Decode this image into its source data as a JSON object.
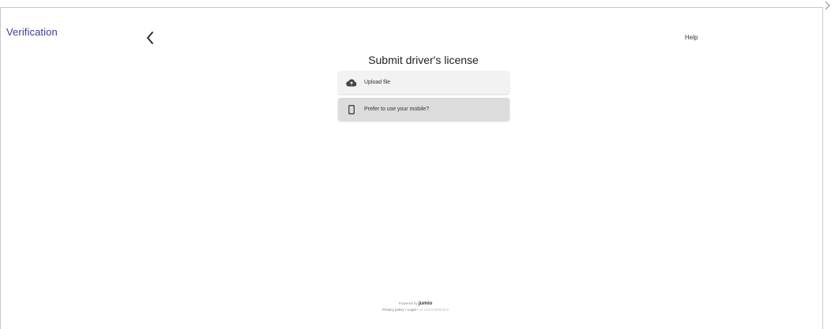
{
  "app": {
    "title": "Verification"
  },
  "header": {
    "help_label": "Help"
  },
  "main": {
    "title": "Submit driver's license",
    "options": [
      {
        "label": "Upload file",
        "icon": "cloud-upload-icon"
      },
      {
        "label": "Prefer to use your mobile?",
        "icon": "mobile-phone-icon"
      }
    ]
  },
  "footer": {
    "powered_prefix": "Powered by",
    "brand": "jumio",
    "privacy_label": "Privacy policy",
    "separator": "•",
    "legal_label": "Legal",
    "version": "v4.123.0-89fd15c0"
  },
  "icons": {
    "back": "chevron-left-icon",
    "sidebar_toggle": "chevron-right-icon"
  },
  "colors": {
    "title": "#3b3f8f",
    "upload_option_bg": "#f2f2f2",
    "mobile_option_bg": "#dcdcdc"
  }
}
